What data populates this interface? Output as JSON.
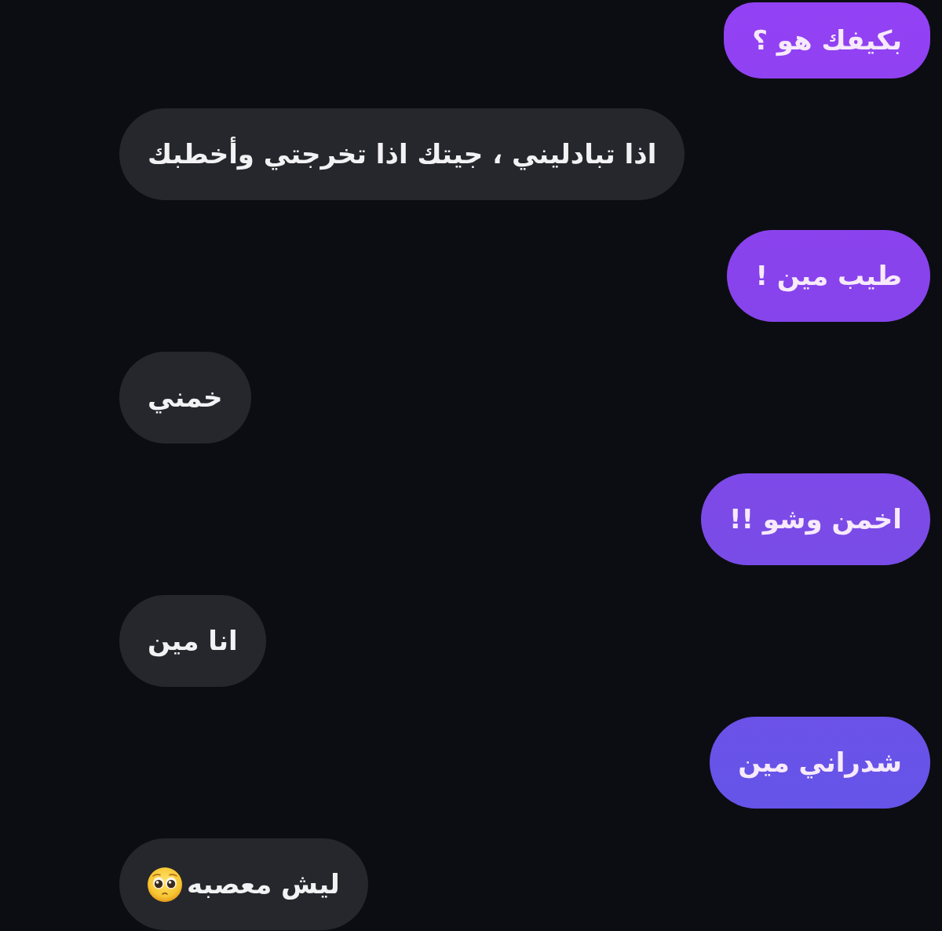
{
  "messages": [
    {
      "kind": "outgoing",
      "text": "بكيفك هو ؟",
      "emoji": false
    },
    {
      "kind": "incoming",
      "text": "اذا تبادليني ، جيتك اذا تخرجتي وأخطبك",
      "emoji": false
    },
    {
      "kind": "outgoing",
      "text": "طيب مين !",
      "emoji": false
    },
    {
      "kind": "incoming",
      "text": "خمني",
      "emoji": false
    },
    {
      "kind": "outgoing",
      "text": "اخمن وشو !!",
      "emoji": false
    },
    {
      "kind": "incoming",
      "text": "انا مين",
      "emoji": false
    },
    {
      "kind": "outgoing",
      "text": "شدراني مين",
      "emoji": false
    },
    {
      "kind": "incoming",
      "text": "ليش معصبه",
      "emoji": true
    }
  ]
}
